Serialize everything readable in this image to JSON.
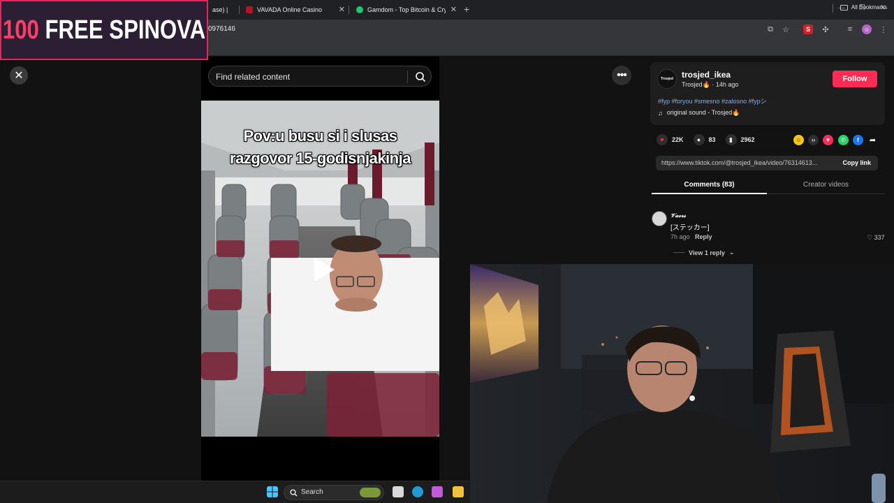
{
  "browser": {
    "tabs": [
      {
        "label": "ase) |"
      },
      {
        "label": "VAVADA Online Casino"
      },
      {
        "label": "Gamdom - Top Bitcoin & Crypt"
      }
    ],
    "url_fragment": "0976146",
    "bookmarks_label": "All Bookmarks"
  },
  "promo": {
    "number": "100",
    "text": " FREE SPINOVA"
  },
  "search": {
    "placeholder": "Find related content"
  },
  "video": {
    "caption_line1": "Pov:u busu si i slusas",
    "caption_line2": "razgovor 15-godisnjakinja"
  },
  "post": {
    "username": "trosjed_ikea",
    "display_name": "Trosjed🔥",
    "time_ago": " · 14h ago",
    "avatar_text": "Trosjed",
    "follow_label": "Follow",
    "hashtags": "#fyp #foryou #smesno #zalosno #fypシ",
    "sound": "original sound - Trosjed🔥",
    "likes": "22K",
    "comments": "83",
    "saves": "2962",
    "link": "https://www.tiktok.com/@trosjed_ikea/video/76314613...",
    "copy_link_label": "Copy link"
  },
  "tabs": {
    "comments": "Comments (83)",
    "creator": "Creator videos"
  },
  "comment": {
    "author": "𝓥𝓪𝓸𝓻𝓼",
    "text": "[ステッカー]",
    "time": "7h ago",
    "reply_label": "Reply",
    "likes": "337",
    "view_replies": "View 1 reply"
  },
  "taskbar": {
    "search_label": "Search"
  },
  "colors": {
    "accent": "#fe2c55",
    "hashtag": "#7fb0ff",
    "promo_border": "#e8265b"
  }
}
